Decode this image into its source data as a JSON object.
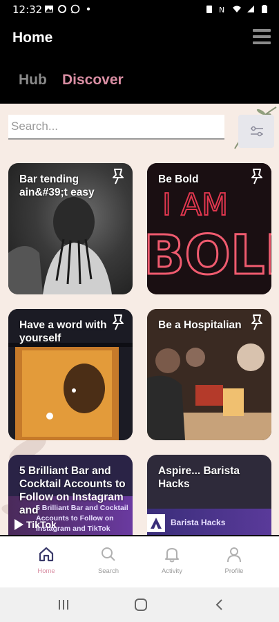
{
  "status_bar": {
    "time": "12:32",
    "left_icons": [
      "gallery-icon",
      "circle-icon",
      "whatsapp-icon",
      "dot-icon"
    ],
    "right_icons": [
      "alarm-icon",
      "nfc-icon",
      "wifi-icon",
      "signal-icon",
      "battery-icon"
    ]
  },
  "header": {
    "title": "Home",
    "menu_icon": "hamburger-icon"
  },
  "tabs": [
    {
      "label": "Hub",
      "active": false
    },
    {
      "label": "Discover",
      "active": true
    }
  ],
  "search": {
    "placeholder": "Search...",
    "value": "",
    "filter_icon": "filter-sliders-icon"
  },
  "cards": [
    {
      "title": "Bar tending ain&#39;t easy",
      "pin_icon": "pin-icon"
    },
    {
      "title": "Be Bold",
      "pin_icon": "pin-icon"
    },
    {
      "title": "Have a word with yourself",
      "pin_icon": "pin-icon"
    },
    {
      "title": "Be a Hospitalian",
      "pin_icon": "pin-icon"
    },
    {
      "title": "5 Brilliant Bar and Cocktail Accounts to Follow on Instagram and",
      "overlay_text": "5 Brilliant Bar and Cocktail Accounts to Follow on Instagram and TikTok",
      "overlay_brand": "TikTok"
    },
    {
      "title": "Aspire... Barista Hacks",
      "overlay_text": "Barista Hacks"
    }
  ],
  "bottom_nav": [
    {
      "label": "Home",
      "icon": "home-icon",
      "active": true
    },
    {
      "label": "Search",
      "icon": "search-icon",
      "active": false
    },
    {
      "label": "Activity",
      "icon": "bell-icon",
      "active": false
    },
    {
      "label": "Profile",
      "icon": "person-icon",
      "active": false
    }
  ],
  "system_nav": [
    "recent-apps-icon",
    "home-button-icon",
    "back-icon"
  ],
  "colors": {
    "accent": "#d98ea3",
    "header_bg": "#000000",
    "content_bg": "#f7ece5",
    "nav_active": "#3a3a6a"
  }
}
